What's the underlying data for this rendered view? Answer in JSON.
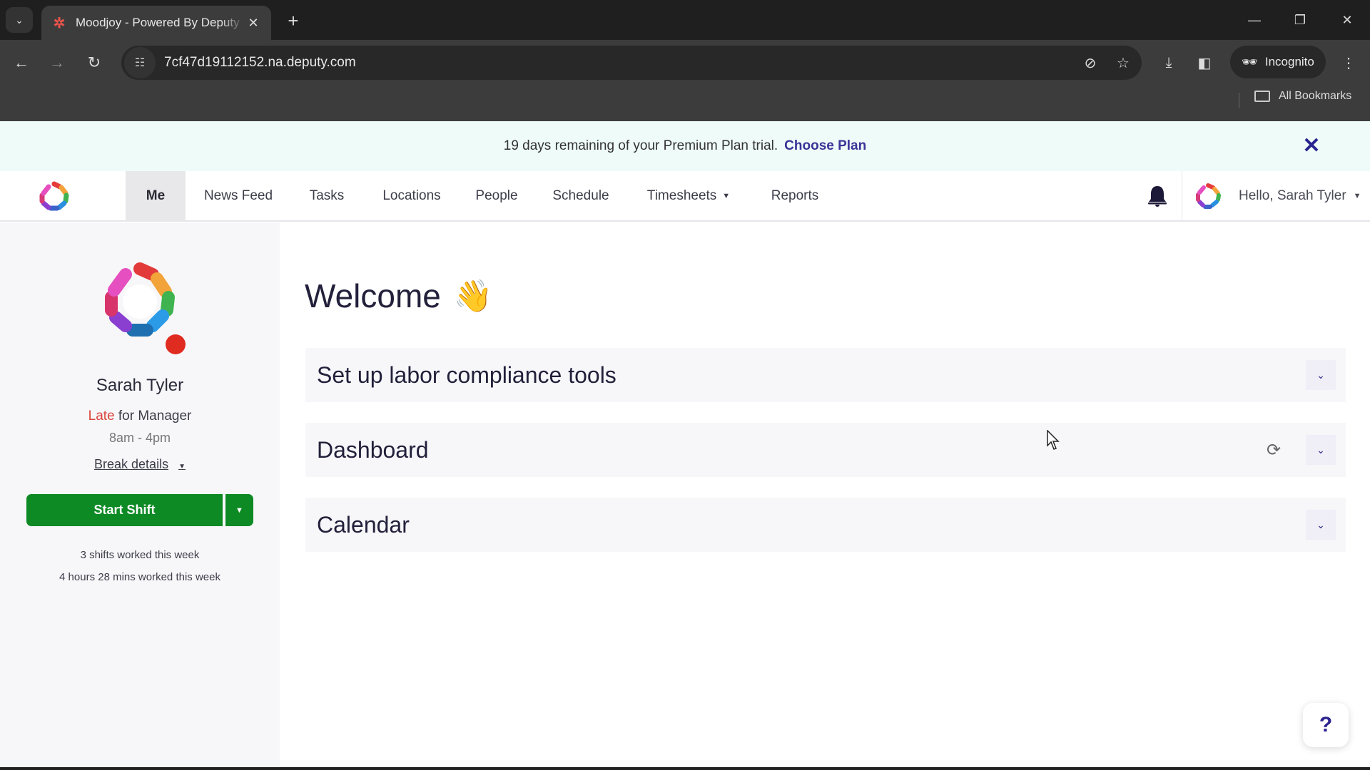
{
  "browser": {
    "tab_title": "Moodjoy - Powered By Deputy",
    "url": "7cf47d19112152.na.deputy.com",
    "incognito_label": "Incognito",
    "bookmarks_label": "All Bookmarks",
    "icons": {
      "tab_search": "chevron-down-icon",
      "favicon": "deputy-star-icon",
      "close": "close-icon",
      "new_tab": "plus-icon",
      "back": "arrow-left-icon",
      "forward": "arrow-right-icon",
      "reload": "reload-icon",
      "site_info": "tune-icon",
      "eye_off": "eye-off-icon",
      "star": "star-icon",
      "download": "download-icon",
      "side_panel": "side-panel-icon",
      "incognito": "incognito-icon",
      "menu": "kebab-menu-icon",
      "folder": "folder-icon"
    },
    "glyphs": {
      "tab_search": "⌄",
      "favicon": "✲",
      "close": "✕",
      "new_tab": "+",
      "minimize": "—",
      "restore": "❐",
      "back": "←",
      "forward": "→",
      "reload": "↻",
      "site_info": "☷",
      "eye_off": "⊘",
      "star": "☆",
      "download": "⤓",
      "side_panel": "◧",
      "incognito": "🕶",
      "menu": "⋮"
    }
  },
  "banner": {
    "message": "19 days remaining of your Premium Plan trial.",
    "link": "Choose Plan",
    "close_glyph": "✕",
    "background": "#eefbf9",
    "link_color": "#3c3397"
  },
  "nav": {
    "items": [
      {
        "label": "Me",
        "active": true
      },
      {
        "label": "News Feed"
      },
      {
        "label": "Tasks"
      },
      {
        "label": "Locations"
      },
      {
        "label": "People"
      },
      {
        "label": "Schedule"
      },
      {
        "label": "Timesheets",
        "has_dropdown": true
      },
      {
        "label": "Reports"
      }
    ],
    "caret": "▼",
    "greeting": "Hello, Sarah Tyler"
  },
  "profile": {
    "name": "Sarah Tyler",
    "status_word": "Late",
    "status_rest": " for Manager",
    "hours": "8am - 4pm",
    "break_details": "Break details",
    "start_shift": "Start Shift",
    "shifts_worked": "3 shifts worked this week",
    "time_worked": "4 hours 28 mins worked this week",
    "status_color": "#e02b21",
    "button_color": "#0e8a25"
  },
  "main": {
    "welcome": "Welcome",
    "wave_emoji": "👋",
    "panels": [
      {
        "title": "Set up labor compliance tools",
        "refresh": false
      },
      {
        "title": "Dashboard",
        "refresh": true
      },
      {
        "title": "Calendar",
        "refresh": false
      }
    ],
    "chevron_glyph": "⌄",
    "refresh_glyph": "⟳",
    "help_glyph": "?"
  }
}
